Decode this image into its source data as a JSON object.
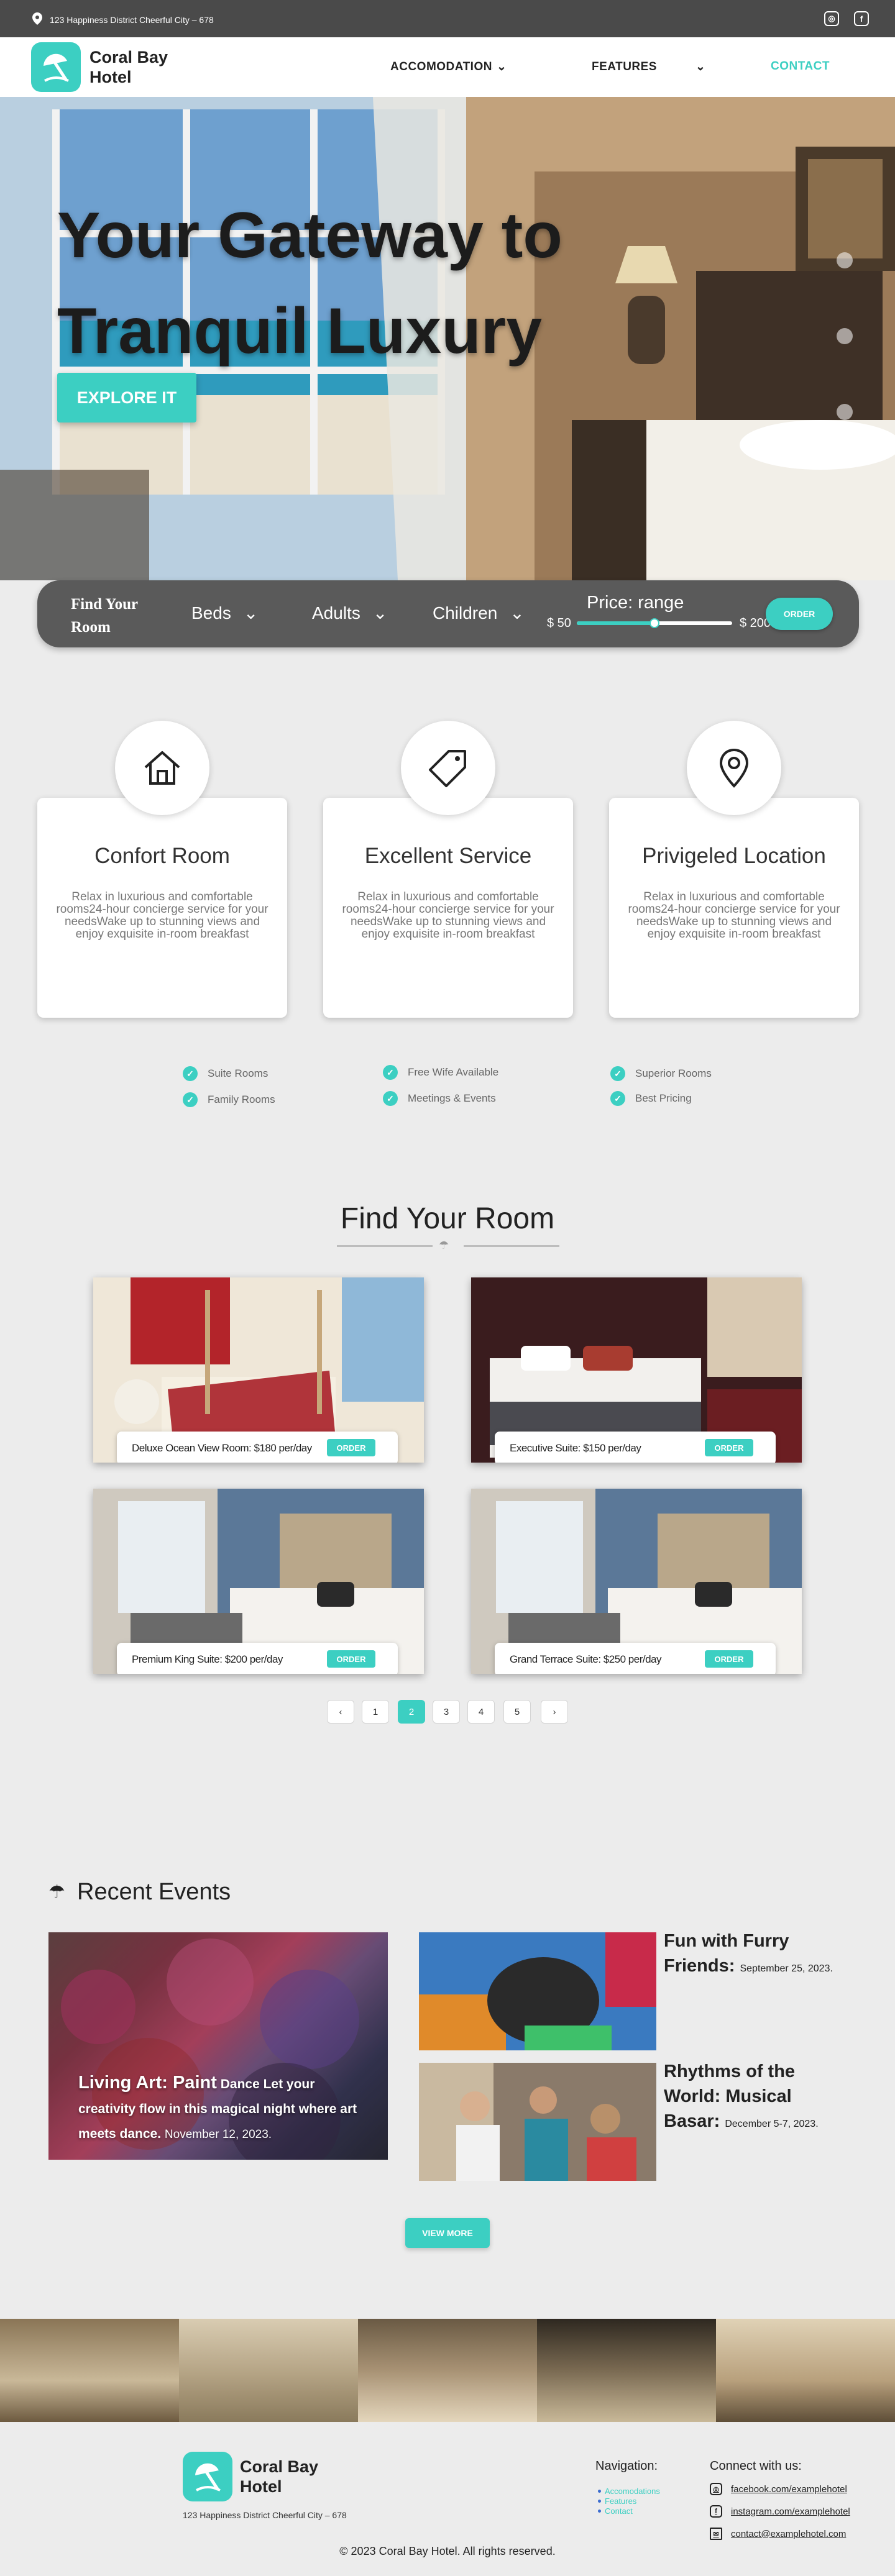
{
  "topbar": {
    "address": "123 Happiness District Cheerful City – 678",
    "instagram_icon": "instagram-icon",
    "facebook_icon": "facebook-icon"
  },
  "nav": {
    "brand": "Coral Bay Hotel",
    "items": [
      {
        "label": "ACCOMODATIONS",
        "dropdown": true
      },
      {
        "label": "FEATURES",
        "dropdown": true
      },
      {
        "label": "CONTACT",
        "dropdown": false
      }
    ]
  },
  "hero": {
    "headline": "Your Gateway to Tranquil Luxury",
    "cta": "EXPLORE IT",
    "slide_count": 3
  },
  "booking": {
    "find_label": "Find Your Room",
    "beds": "Beds",
    "adults": "Adults",
    "children": "Children",
    "price_label": "Price: range",
    "price_min": "$ 50",
    "price_max": "$ 200",
    "slider_value": 0.5,
    "order": "ORDER"
  },
  "features": [
    {
      "icon": "home-icon",
      "title": "Confort Room",
      "desc": "Relax in luxurious and comfortable rooms24-hour concierge service for your needsWake up to stunning views and enjoy exquisite in-room breakfast"
    },
    {
      "icon": "tag-icon",
      "title": "Excellent Service",
      "desc": "Relax in luxurious and comfortable rooms24-hour concierge service for your needsWake up to stunning views and enjoy exquisite in-room breakfast"
    },
    {
      "icon": "location-pin-icon",
      "title": "Privigeled Location",
      "desc": "Relax in luxurious and comfortable rooms24-hour concierge service for your needsWake up to stunning views and enjoy exquisite in-room breakfast"
    }
  ],
  "amenities": {
    "col1": [
      "Suite Rooms",
      "Family Rooms"
    ],
    "col2": [
      "Free Wife Available",
      "Meetings & Events"
    ],
    "col3": [
      "Superior Rooms",
      "Best Pricing"
    ]
  },
  "rooms_section": {
    "title": "Find Your Room",
    "rooms": [
      {
        "label": "Deluxe Ocean View Room: $180 per/day",
        "order": "ORDER"
      },
      {
        "label": "Executive Suite: $150 per/day",
        "order": "ORDER"
      },
      {
        "label": "Premium King Suite: $200 per/day",
        "order": "ORDER"
      },
      {
        "label": "Grand Terrace Suite: $250 per/day",
        "order": "ORDER"
      }
    ],
    "pagination": {
      "prev": "‹",
      "pages": [
        "1",
        "2",
        "3",
        "4",
        "5"
      ],
      "active": "2",
      "next": "›"
    }
  },
  "events": {
    "title": "Recent Events",
    "featured": {
      "title": "Living Art: Paint",
      "body": "Dance Let your creativity flow in this magical night where art meets dance.",
      "date": "November 12, 2023."
    },
    "items": [
      {
        "title": "Fun with Furry Friends:",
        "date": "September 25, 2023."
      },
      {
        "title": "Rhythms of the World: Musical Basar:",
        "date": "December 5-7, 2023."
      }
    ],
    "view_more": "VIEW MORE"
  },
  "footer": {
    "brand": "Coral Bay Hotel",
    "address": "123 Happiness District Cheerful City – 678",
    "nav_heading": "Navigation:",
    "nav_links": [
      "Accomodations",
      "Features",
      "Contact"
    ],
    "connect_heading": "Connect with us:",
    "contacts": [
      {
        "icon": "instagram-icon",
        "text": "facebook.com/examplehotel"
      },
      {
        "icon": "facebook-icon",
        "text": "instagram.com/examplehotel"
      },
      {
        "icon": "mail-icon",
        "text": "contact@examplehotel.com"
      }
    ],
    "copyright": "© 2023 Coral Bay Hotel. All rights reserved."
  },
  "colors": {
    "accent": "#3ccfc2",
    "dark": "#4a4a4a",
    "background": "#ececec"
  }
}
